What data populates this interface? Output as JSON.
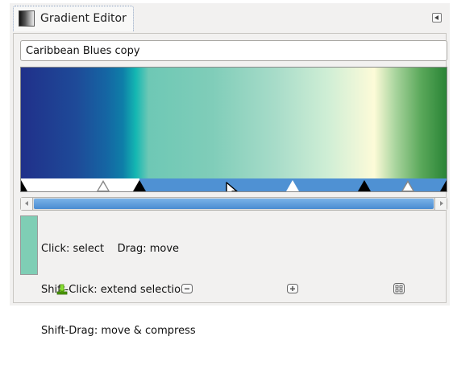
{
  "tab": {
    "title": "Gradient Editor"
  },
  "gradient_name": {
    "value": "Caribbean Blues copy"
  },
  "hints": {
    "line1": "Click: select    Drag: move",
    "line2": "Shift-Click: extend selection",
    "line3": "Shift-Drag: move & compress"
  },
  "colors": {
    "selection": "#4f91d3",
    "swatch": "#7fceb5"
  },
  "icons": {
    "tab": "gradient-icon",
    "menu": "tab-menu-icon",
    "action1": "save-icon",
    "action2": "zoom-out-icon",
    "action3": "zoom-in-icon",
    "action4": "zoom-all-icon"
  }
}
